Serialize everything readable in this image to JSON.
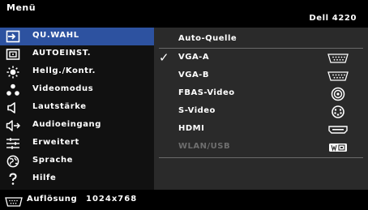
{
  "header": {
    "title": "Menü",
    "model": "Dell 4220"
  },
  "menu": {
    "items": [
      {
        "label": "QU.WAHL",
        "icon": "input-source-icon",
        "selected": true
      },
      {
        "label": "AUTOEINST.",
        "icon": "auto-adjust-icon",
        "selected": false
      },
      {
        "label": "Hellg./Kontr.",
        "icon": "brightness-icon",
        "selected": false
      },
      {
        "label": "Videomodus",
        "icon": "video-mode-icon",
        "selected": false
      },
      {
        "label": "Lautstärke",
        "icon": "volume-icon",
        "selected": false
      },
      {
        "label": "Audioeingang",
        "icon": "audio-input-icon",
        "selected": false
      },
      {
        "label": "Erweitert",
        "icon": "advanced-settings-icon",
        "selected": false
      },
      {
        "label": "Sprache",
        "icon": "language-icon",
        "selected": false
      },
      {
        "label": "Hilfe",
        "icon": "help-icon",
        "selected": false
      }
    ]
  },
  "submenu": {
    "items": [
      {
        "label": "Auto-Quelle",
        "checked": false,
        "icon": "",
        "enabled": true
      },
      {
        "label": "VGA-A",
        "checked": true,
        "icon": "vga-icon",
        "enabled": true
      },
      {
        "label": "VGA-B",
        "checked": false,
        "icon": "vga-icon",
        "enabled": true
      },
      {
        "label": "FBAS-Video",
        "checked": false,
        "icon": "composite-video-icon",
        "enabled": true
      },
      {
        "label": "S-Video",
        "checked": false,
        "icon": "s-video-icon",
        "enabled": true
      },
      {
        "label": "HDMI",
        "checked": false,
        "icon": "hdmi-icon",
        "enabled": true
      },
      {
        "label": "WLAN/USB",
        "checked": false,
        "icon": "wlan-usb-icon",
        "enabled": false
      }
    ],
    "check_glyph": "✓"
  },
  "footer": {
    "label": "Auflösung",
    "value": "1024x768",
    "icon": "vga-icon"
  },
  "colors": {
    "selected_bg": "#2d52a0",
    "menu_bg": "#111111",
    "submenu_bg": "#2a2a2a",
    "disabled_text": "#6e6e6e"
  }
}
